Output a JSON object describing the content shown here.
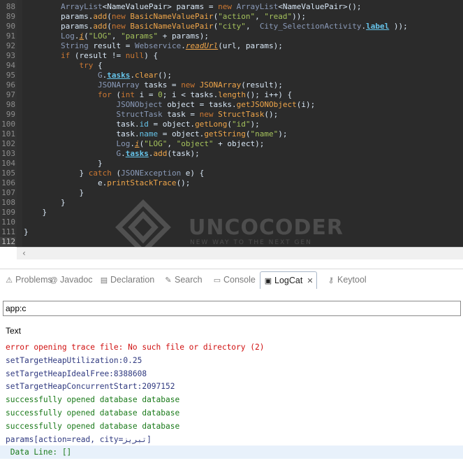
{
  "colors": {
    "editor_bg": "#2b2b2b",
    "keyword": "#cc7832",
    "type": "#8a9ab8",
    "string": "#a5c25c",
    "field": "#66c3e9",
    "method": "#f0a64a",
    "log_error": "#d01010",
    "log_info": "#303a80",
    "log_debug": "#1a7a1a"
  },
  "editor": {
    "lines": [
      {
        "num": "88",
        "segments": [
          {
            "t": "        "
          },
          {
            "t": "ArrayList",
            "c": "type"
          },
          {
            "t": "<NameValuePair> params = "
          },
          {
            "t": "new",
            "c": "keyword"
          },
          {
            "t": " "
          },
          {
            "t": "ArrayList",
            "c": "type"
          },
          {
            "t": "<NameValuePair>();"
          }
        ]
      },
      {
        "num": "89",
        "segments": [
          {
            "t": "        params."
          },
          {
            "t": "add",
            "c": "method"
          },
          {
            "t": "("
          },
          {
            "t": "new",
            "c": "keyword"
          },
          {
            "t": " "
          },
          {
            "t": "BasicNameValuePair",
            "c": "method"
          },
          {
            "t": "("
          },
          {
            "t": "\"action\"",
            "c": "string"
          },
          {
            "t": ", "
          },
          {
            "t": "\"read\"",
            "c": "string"
          },
          {
            "t": "));"
          }
        ]
      },
      {
        "num": "90",
        "segments": [
          {
            "t": "        params."
          },
          {
            "t": "add",
            "c": "method"
          },
          {
            "t": "("
          },
          {
            "t": "new",
            "c": "keyword"
          },
          {
            "t": " "
          },
          {
            "t": "BasicNameValuePair",
            "c": "method"
          },
          {
            "t": "("
          },
          {
            "t": "\"city\"",
            "c": "string"
          },
          {
            "t": ",  "
          },
          {
            "t": "City_SelectionActivity",
            "c": "type"
          },
          {
            "t": "."
          },
          {
            "t": "label",
            "c": "fieldu"
          },
          {
            "t": " ));"
          }
        ]
      },
      {
        "num": "91",
        "segments": [
          {
            "t": "        "
          },
          {
            "t": "Log",
            "c": "type"
          },
          {
            "t": "."
          },
          {
            "t": "i",
            "c": "methodu"
          },
          {
            "t": "("
          },
          {
            "t": "\"LOG\"",
            "c": "string"
          },
          {
            "t": ", "
          },
          {
            "t": "\"params\"",
            "c": "string"
          },
          {
            "t": " + params);"
          }
        ]
      },
      {
        "num": "92",
        "segments": [
          {
            "t": "        "
          },
          {
            "t": "String",
            "c": "type"
          },
          {
            "t": " result = "
          },
          {
            "t": "Webservice",
            "c": "type"
          },
          {
            "t": "."
          },
          {
            "t": "readUrl",
            "c": "methodu"
          },
          {
            "t": "(url, params);"
          }
        ]
      },
      {
        "num": "93",
        "segments": [
          {
            "t": "        "
          },
          {
            "t": "if",
            "c": "keyword"
          },
          {
            "t": " (result != "
          },
          {
            "t": "null",
            "c": "keyword"
          },
          {
            "t": ") {"
          }
        ]
      },
      {
        "num": "94",
        "segments": [
          {
            "t": "            "
          },
          {
            "t": "try",
            "c": "keyword"
          },
          {
            "t": " {"
          }
        ]
      },
      {
        "num": "95",
        "segments": [
          {
            "t": "                "
          },
          {
            "t": "G",
            "c": "type"
          },
          {
            "t": "."
          },
          {
            "t": "tasks",
            "c": "fieldu"
          },
          {
            "t": "."
          },
          {
            "t": "clear",
            "c": "method"
          },
          {
            "t": "();"
          }
        ]
      },
      {
        "num": "96",
        "segments": [
          {
            "t": "                "
          },
          {
            "t": "JSONArray",
            "c": "type"
          },
          {
            "t": " tasks = "
          },
          {
            "t": "new",
            "c": "keyword"
          },
          {
            "t": " "
          },
          {
            "t": "JSONArray",
            "c": "method"
          },
          {
            "t": "(result);"
          }
        ]
      },
      {
        "num": "97",
        "segments": [
          {
            "t": "                "
          },
          {
            "t": "for",
            "c": "keyword"
          },
          {
            "t": " ("
          },
          {
            "t": "int",
            "c": "keyword"
          },
          {
            "t": " i = "
          },
          {
            "t": "0",
            "c": "string"
          },
          {
            "t": "; i < tasks."
          },
          {
            "t": "length",
            "c": "method"
          },
          {
            "t": "(); i++) {"
          }
        ]
      },
      {
        "num": "98",
        "segments": [
          {
            "t": "                    "
          },
          {
            "t": "JSONObject",
            "c": "type"
          },
          {
            "t": " object = tasks."
          },
          {
            "t": "getJSONObject",
            "c": "method"
          },
          {
            "t": "(i);"
          }
        ]
      },
      {
        "num": "99",
        "segments": [
          {
            "t": "                    "
          },
          {
            "t": "StructTask",
            "c": "type"
          },
          {
            "t": " task = "
          },
          {
            "t": "new",
            "c": "keyword"
          },
          {
            "t": " "
          },
          {
            "t": "StructTask",
            "c": "method"
          },
          {
            "t": "();"
          }
        ]
      },
      {
        "num": "100",
        "segments": [
          {
            "t": "                    task."
          },
          {
            "t": "id",
            "c": "field"
          },
          {
            "t": " = object."
          },
          {
            "t": "getLong",
            "c": "method"
          },
          {
            "t": "("
          },
          {
            "t": "\"id\"",
            "c": "string"
          },
          {
            "t": ");"
          }
        ]
      },
      {
        "num": "101",
        "segments": [
          {
            "t": "                    task."
          },
          {
            "t": "name",
            "c": "field"
          },
          {
            "t": " = object."
          },
          {
            "t": "getString",
            "c": "method"
          },
          {
            "t": "("
          },
          {
            "t": "\"name\"",
            "c": "string"
          },
          {
            "t": ");"
          }
        ]
      },
      {
        "num": "102",
        "segments": [
          {
            "t": "                    "
          },
          {
            "t": "Log",
            "c": "type"
          },
          {
            "t": "."
          },
          {
            "t": "i",
            "c": "methodu"
          },
          {
            "t": "("
          },
          {
            "t": "\"LOG\"",
            "c": "string"
          },
          {
            "t": ", "
          },
          {
            "t": "\"object\"",
            "c": "string"
          },
          {
            "t": " + object);"
          }
        ]
      },
      {
        "num": "103",
        "segments": [
          {
            "t": "                    "
          },
          {
            "t": "G",
            "c": "type"
          },
          {
            "t": "."
          },
          {
            "t": "tasks",
            "c": "fieldu"
          },
          {
            "t": "."
          },
          {
            "t": "add",
            "c": "method"
          },
          {
            "t": "(task);"
          }
        ]
      },
      {
        "num": "104",
        "segments": [
          {
            "t": "                }"
          }
        ]
      },
      {
        "num": "105",
        "segments": [
          {
            "t": "            } "
          },
          {
            "t": "catch",
            "c": "keyword"
          },
          {
            "t": " ("
          },
          {
            "t": "JSONException",
            "c": "type"
          },
          {
            "t": " e) {"
          }
        ]
      },
      {
        "num": "106",
        "segments": [
          {
            "t": "                e."
          },
          {
            "t": "printStackTrace",
            "c": "method"
          },
          {
            "t": "();"
          }
        ]
      },
      {
        "num": "107",
        "segments": [
          {
            "t": "            }"
          }
        ]
      },
      {
        "num": "108",
        "segments": [
          {
            "t": "        }"
          }
        ]
      },
      {
        "num": "109",
        "segments": [
          {
            "t": "    }"
          }
        ]
      },
      {
        "num": "110",
        "segments": [
          {
            "t": ""
          }
        ]
      },
      {
        "num": "111",
        "segments": [
          {
            "t": "}"
          }
        ]
      },
      {
        "num": "112",
        "segments": [
          {
            "t": ""
          }
        ]
      }
    ],
    "current_line": "112",
    "watermark_title": "UNCOCODER",
    "watermark_subtitle": "NEW WAY TO THE NEXT GEN"
  },
  "tabs": [
    {
      "label": "Problems",
      "icon": "problems-icon",
      "glyph": "⚠"
    },
    {
      "label": "Javadoc",
      "icon": "javadoc-icon",
      "glyph": "@"
    },
    {
      "label": "Declaration",
      "icon": "declaration-icon",
      "glyph": "▤"
    },
    {
      "label": "Search",
      "icon": "search-icon",
      "glyph": "✎"
    },
    {
      "label": "Console",
      "icon": "console-icon",
      "glyph": "▭"
    },
    {
      "label": "LogCat",
      "icon": "logcat-icon",
      "glyph": "▣",
      "active": true
    },
    {
      "label": "Keytool",
      "icon": "key-icon",
      "glyph": "⚷"
    }
  ],
  "filter": {
    "value": "app:c"
  },
  "log": {
    "column_header": "Text",
    "rows": [
      {
        "text": "error opening trace file: No such file or directory (2)",
        "level": "error"
      },
      {
        "text": "setTargetHeapUtilization:0.25",
        "level": "info"
      },
      {
        "text": "setTargetHeapIdealFree:8388608",
        "level": "info"
      },
      {
        "text": "setTargetHeapConcurrentStart:2097152",
        "level": "info"
      },
      {
        "text": "successfully opened database database",
        "level": "debug"
      },
      {
        "text": "successfully opened database database",
        "level": "debug"
      },
      {
        "text": "successfully opened database database",
        "level": "debug"
      },
      {
        "text": "params[action=read, city=تبریز]",
        "level": "info"
      },
      {
        "text": " Data Line: []",
        "level": "debug",
        "selected": true
      }
    ]
  }
}
